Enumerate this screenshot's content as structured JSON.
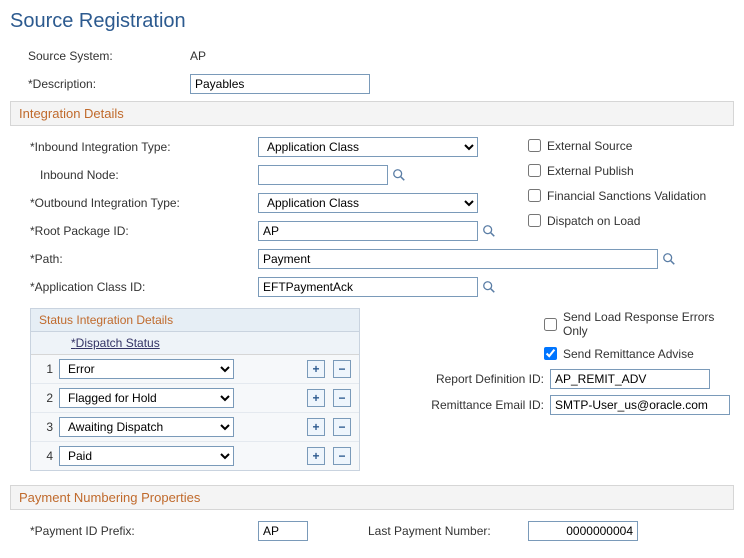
{
  "page_title": "Source Registration",
  "top": {
    "source_system_label": "Source System:",
    "source_system_value": "AP",
    "description_label": "Description:",
    "description_value": "Payables"
  },
  "sections": {
    "integration_details": "Integration Details",
    "payment_numbering": "Payment Numbering Properties"
  },
  "integration": {
    "inbound_type_label": "Inbound Integration Type:",
    "inbound_type_value": "Application Class",
    "inbound_node_label": "Inbound Node:",
    "inbound_node_value": "",
    "outbound_type_label": "Outbound Integration Type:",
    "outbound_type_value": "Application Class",
    "root_pkg_label": "Root Package ID:",
    "root_pkg_value": "AP",
    "path_label": "Path:",
    "path_value": "Payment",
    "app_class_label": "Application Class ID:",
    "app_class_value": "EFTPaymentAck"
  },
  "flags": {
    "external_source": "External Source",
    "external_publish": "External Publish",
    "fin_sanctions": "Financial Sanctions Validation",
    "dispatch_on_load": "Dispatch on Load",
    "send_load_errors": "Send Load Response Errors Only",
    "send_remit_advise": "Send Remittance Advise"
  },
  "remit": {
    "report_def_label": "Report Definition ID:",
    "report_def_value": "AP_REMIT_ADV",
    "remit_email_label": "Remittance Email ID:",
    "remit_email_value": "SMTP-User_us@oracle.com"
  },
  "status_box": {
    "title": "Status Integration Details",
    "column_label": "Dispatch Status",
    "rows": [
      {
        "n": "1",
        "value": "Error"
      },
      {
        "n": "2",
        "value": "Flagged for Hold"
      },
      {
        "n": "3",
        "value": "Awaiting Dispatch"
      },
      {
        "n": "4",
        "value": "Paid"
      }
    ]
  },
  "payment_num": {
    "prefix_label": "Payment ID Prefix:",
    "prefix_value": "AP",
    "last_num_label": "Last Payment Number:",
    "last_num_value": "0000000004"
  },
  "icons": {
    "lookup": "lookup-icon",
    "add": "+",
    "remove": "−"
  }
}
